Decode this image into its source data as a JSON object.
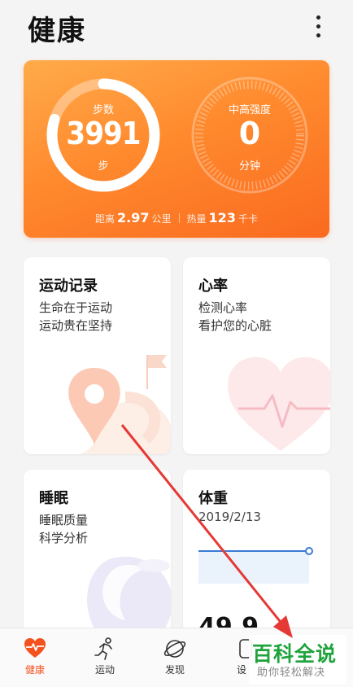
{
  "header": {
    "title": "健康"
  },
  "hero": {
    "steps_label": "步数",
    "steps_value": "3991",
    "steps_unit": "步",
    "steps_progress": 0.8,
    "intensity_label": "中高强度",
    "intensity_value": "0",
    "intensity_unit": "分钟",
    "distance_label": "距离",
    "distance_value": "2.97",
    "distance_unit": "公里",
    "calories_label": "热量",
    "calories_value": "123",
    "calories_unit": "千卡"
  },
  "cards": {
    "exercise": {
      "title": "运动记录",
      "line1": "生命在于运动",
      "line2": "运动贵在坚持"
    },
    "heart": {
      "title": "心率",
      "line1": "检测心率",
      "line2": "看护您的心脏"
    },
    "sleep": {
      "title": "睡眠",
      "line1": "睡眠质量",
      "line2": "科学分析"
    },
    "weight": {
      "title": "体重",
      "date": "2019/2/13",
      "partial_value": "49.9"
    }
  },
  "nav": {
    "items": [
      {
        "label": "健康",
        "icon": "heart-pulse-icon",
        "active": true
      },
      {
        "label": "运动",
        "icon": "running-icon",
        "active": false
      },
      {
        "label": "发现",
        "icon": "planet-icon",
        "active": false
      },
      {
        "label": "设",
        "icon": "device-icon",
        "active": false
      }
    ]
  },
  "watermark": {
    "brand": "百科全说",
    "slogan": "助你轻松解决"
  },
  "colors": {
    "accent": "#ff8a2e",
    "active_nav": "#f4511e",
    "arrow": "#e53935",
    "weight_line": "#3a7bd5"
  }
}
